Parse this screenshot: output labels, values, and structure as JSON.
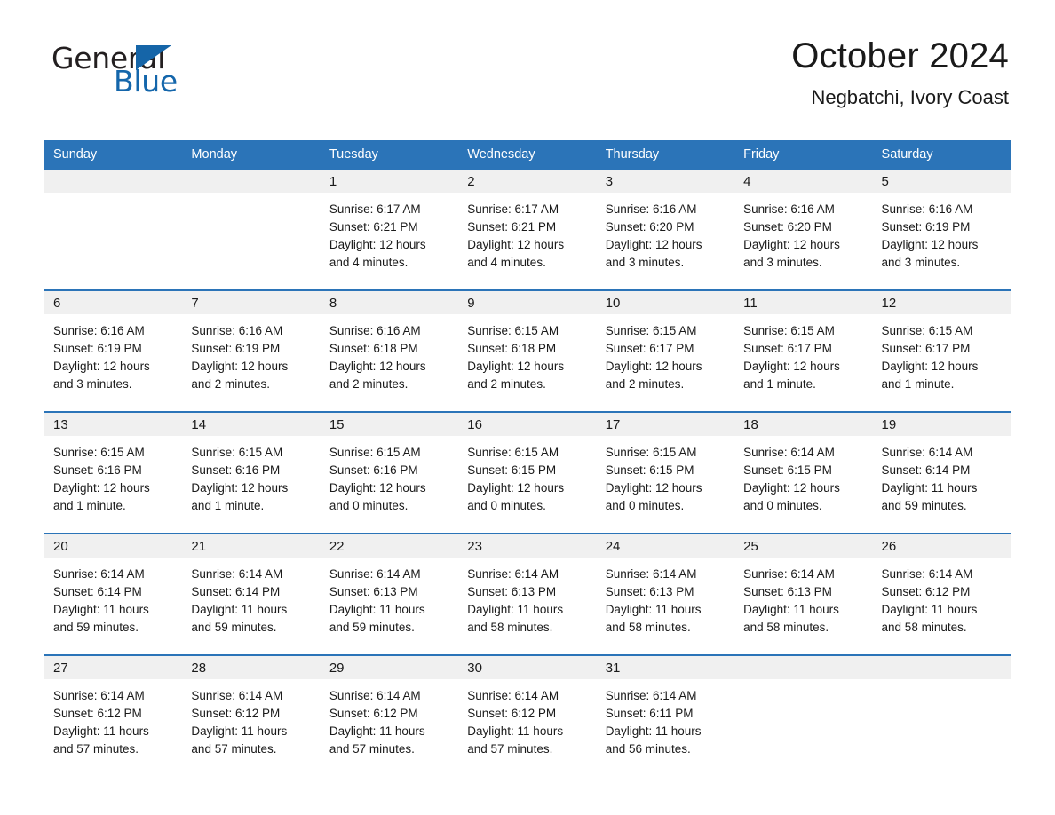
{
  "brand": {
    "logo_text_1": "General",
    "logo_text_2": "Blue",
    "triangle_icon": "blue-triangle-icon",
    "accent_color": "#2b74b8",
    "logo_blue": "#1466ab"
  },
  "header": {
    "title": "October 2024",
    "location": "Negbatchi, Ivory Coast"
  },
  "calendar": {
    "weekdays": [
      "Sunday",
      "Monday",
      "Tuesday",
      "Wednesday",
      "Thursday",
      "Friday",
      "Saturday"
    ],
    "header_bg": "#2b74b8",
    "daynum_bg": "#f0f0f0",
    "weeks": [
      [
        {
          "day": "",
          "sunrise": "",
          "sunset": "",
          "daylight_1": "",
          "daylight_2": ""
        },
        {
          "day": "",
          "sunrise": "",
          "sunset": "",
          "daylight_1": "",
          "daylight_2": ""
        },
        {
          "day": "1",
          "sunrise": "Sunrise: 6:17 AM",
          "sunset": "Sunset: 6:21 PM",
          "daylight_1": "Daylight: 12 hours",
          "daylight_2": "and 4 minutes."
        },
        {
          "day": "2",
          "sunrise": "Sunrise: 6:17 AM",
          "sunset": "Sunset: 6:21 PM",
          "daylight_1": "Daylight: 12 hours",
          "daylight_2": "and 4 minutes."
        },
        {
          "day": "3",
          "sunrise": "Sunrise: 6:16 AM",
          "sunset": "Sunset: 6:20 PM",
          "daylight_1": "Daylight: 12 hours",
          "daylight_2": "and 3 minutes."
        },
        {
          "day": "4",
          "sunrise": "Sunrise: 6:16 AM",
          "sunset": "Sunset: 6:20 PM",
          "daylight_1": "Daylight: 12 hours",
          "daylight_2": "and 3 minutes."
        },
        {
          "day": "5",
          "sunrise": "Sunrise: 6:16 AM",
          "sunset": "Sunset: 6:19 PM",
          "daylight_1": "Daylight: 12 hours",
          "daylight_2": "and 3 minutes."
        }
      ],
      [
        {
          "day": "6",
          "sunrise": "Sunrise: 6:16 AM",
          "sunset": "Sunset: 6:19 PM",
          "daylight_1": "Daylight: 12 hours",
          "daylight_2": "and 3 minutes."
        },
        {
          "day": "7",
          "sunrise": "Sunrise: 6:16 AM",
          "sunset": "Sunset: 6:19 PM",
          "daylight_1": "Daylight: 12 hours",
          "daylight_2": "and 2 minutes."
        },
        {
          "day": "8",
          "sunrise": "Sunrise: 6:16 AM",
          "sunset": "Sunset: 6:18 PM",
          "daylight_1": "Daylight: 12 hours",
          "daylight_2": "and 2 minutes."
        },
        {
          "day": "9",
          "sunrise": "Sunrise: 6:15 AM",
          "sunset": "Sunset: 6:18 PM",
          "daylight_1": "Daylight: 12 hours",
          "daylight_2": "and 2 minutes."
        },
        {
          "day": "10",
          "sunrise": "Sunrise: 6:15 AM",
          "sunset": "Sunset: 6:17 PM",
          "daylight_1": "Daylight: 12 hours",
          "daylight_2": "and 2 minutes."
        },
        {
          "day": "11",
          "sunrise": "Sunrise: 6:15 AM",
          "sunset": "Sunset: 6:17 PM",
          "daylight_1": "Daylight: 12 hours",
          "daylight_2": "and 1 minute."
        },
        {
          "day": "12",
          "sunrise": "Sunrise: 6:15 AM",
          "sunset": "Sunset: 6:17 PM",
          "daylight_1": "Daylight: 12 hours",
          "daylight_2": "and 1 minute."
        }
      ],
      [
        {
          "day": "13",
          "sunrise": "Sunrise: 6:15 AM",
          "sunset": "Sunset: 6:16 PM",
          "daylight_1": "Daylight: 12 hours",
          "daylight_2": "and 1 minute."
        },
        {
          "day": "14",
          "sunrise": "Sunrise: 6:15 AM",
          "sunset": "Sunset: 6:16 PM",
          "daylight_1": "Daylight: 12 hours",
          "daylight_2": "and 1 minute."
        },
        {
          "day": "15",
          "sunrise": "Sunrise: 6:15 AM",
          "sunset": "Sunset: 6:16 PM",
          "daylight_1": "Daylight: 12 hours",
          "daylight_2": "and 0 minutes."
        },
        {
          "day": "16",
          "sunrise": "Sunrise: 6:15 AM",
          "sunset": "Sunset: 6:15 PM",
          "daylight_1": "Daylight: 12 hours",
          "daylight_2": "and 0 minutes."
        },
        {
          "day": "17",
          "sunrise": "Sunrise: 6:15 AM",
          "sunset": "Sunset: 6:15 PM",
          "daylight_1": "Daylight: 12 hours",
          "daylight_2": "and 0 minutes."
        },
        {
          "day": "18",
          "sunrise": "Sunrise: 6:14 AM",
          "sunset": "Sunset: 6:15 PM",
          "daylight_1": "Daylight: 12 hours",
          "daylight_2": "and 0 minutes."
        },
        {
          "day": "19",
          "sunrise": "Sunrise: 6:14 AM",
          "sunset": "Sunset: 6:14 PM",
          "daylight_1": "Daylight: 11 hours",
          "daylight_2": "and 59 minutes."
        }
      ],
      [
        {
          "day": "20",
          "sunrise": "Sunrise: 6:14 AM",
          "sunset": "Sunset: 6:14 PM",
          "daylight_1": "Daylight: 11 hours",
          "daylight_2": "and 59 minutes."
        },
        {
          "day": "21",
          "sunrise": "Sunrise: 6:14 AM",
          "sunset": "Sunset: 6:14 PM",
          "daylight_1": "Daylight: 11 hours",
          "daylight_2": "and 59 minutes."
        },
        {
          "day": "22",
          "sunrise": "Sunrise: 6:14 AM",
          "sunset": "Sunset: 6:13 PM",
          "daylight_1": "Daylight: 11 hours",
          "daylight_2": "and 59 minutes."
        },
        {
          "day": "23",
          "sunrise": "Sunrise: 6:14 AM",
          "sunset": "Sunset: 6:13 PM",
          "daylight_1": "Daylight: 11 hours",
          "daylight_2": "and 58 minutes."
        },
        {
          "day": "24",
          "sunrise": "Sunrise: 6:14 AM",
          "sunset": "Sunset: 6:13 PM",
          "daylight_1": "Daylight: 11 hours",
          "daylight_2": "and 58 minutes."
        },
        {
          "day": "25",
          "sunrise": "Sunrise: 6:14 AM",
          "sunset": "Sunset: 6:13 PM",
          "daylight_1": "Daylight: 11 hours",
          "daylight_2": "and 58 minutes."
        },
        {
          "day": "26",
          "sunrise": "Sunrise: 6:14 AM",
          "sunset": "Sunset: 6:12 PM",
          "daylight_1": "Daylight: 11 hours",
          "daylight_2": "and 58 minutes."
        }
      ],
      [
        {
          "day": "27",
          "sunrise": "Sunrise: 6:14 AM",
          "sunset": "Sunset: 6:12 PM",
          "daylight_1": "Daylight: 11 hours",
          "daylight_2": "and 57 minutes."
        },
        {
          "day": "28",
          "sunrise": "Sunrise: 6:14 AM",
          "sunset": "Sunset: 6:12 PM",
          "daylight_1": "Daylight: 11 hours",
          "daylight_2": "and 57 minutes."
        },
        {
          "day": "29",
          "sunrise": "Sunrise: 6:14 AM",
          "sunset": "Sunset: 6:12 PM",
          "daylight_1": "Daylight: 11 hours",
          "daylight_2": "and 57 minutes."
        },
        {
          "day": "30",
          "sunrise": "Sunrise: 6:14 AM",
          "sunset": "Sunset: 6:12 PM",
          "daylight_1": "Daylight: 11 hours",
          "daylight_2": "and 57 minutes."
        },
        {
          "day": "31",
          "sunrise": "Sunrise: 6:14 AM",
          "sunset": "Sunset: 6:11 PM",
          "daylight_1": "Daylight: 11 hours",
          "daylight_2": "and 56 minutes."
        },
        {
          "day": "",
          "sunrise": "",
          "sunset": "",
          "daylight_1": "",
          "daylight_2": ""
        },
        {
          "day": "",
          "sunrise": "",
          "sunset": "",
          "daylight_1": "",
          "daylight_2": ""
        }
      ]
    ]
  }
}
